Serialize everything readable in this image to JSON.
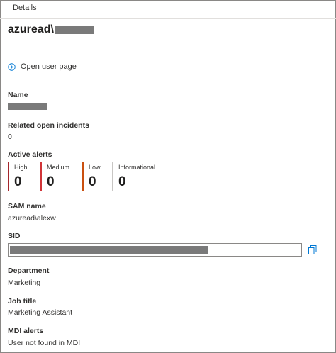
{
  "tabs": [
    {
      "label": "Details"
    }
  ],
  "header": {
    "title": "azuread\\"
  },
  "open_user_page": {
    "label": "Open user page",
    "icon": "chevron-right-circle-icon"
  },
  "fields": {
    "name": {
      "label": "Name"
    },
    "related_incidents": {
      "label": "Related open incidents",
      "value": "0"
    },
    "active_alerts": {
      "label": "Active alerts",
      "items": [
        {
          "severity": "High",
          "count": "0",
          "color": "#a4262c"
        },
        {
          "severity": "Medium",
          "count": "0",
          "color": "#d13438"
        },
        {
          "severity": "Low",
          "count": "0",
          "color": "#ca5010"
        },
        {
          "severity": "Informational",
          "count": "0",
          "color": "#c8c6c4"
        }
      ]
    },
    "sam_name": {
      "label": "SAM name",
      "value": "azuread\\alexw"
    },
    "sid": {
      "label": "SID",
      "copy_icon": "copy-icon"
    },
    "department": {
      "label": "Department",
      "value": "Marketing"
    },
    "job_title": {
      "label": "Job title",
      "value": "Marketing Assistant"
    },
    "mdi_alerts": {
      "label": "MDI alerts",
      "value": "User not found in MDI"
    }
  },
  "colors": {
    "accent": "#0078d4",
    "redaction": "#7a7a7a"
  }
}
